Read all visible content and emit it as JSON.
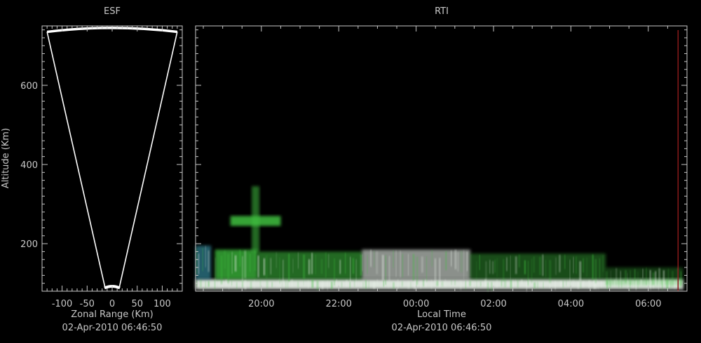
{
  "colors": {
    "background": "#000000",
    "axis": "#c8c8c8",
    "fan_outline": "#ffffff",
    "echo_green": "#3fbf3f",
    "echo_white": "#e8f0e8",
    "echo_cyan": "#3fa8c0",
    "time_marker": "#8b1a1a"
  },
  "chart_data": [
    {
      "type": "scatter",
      "title": "ESF",
      "xlabel": "Zonal Range (Km)",
      "ylabel": "Altitude (Km)",
      "footer": "02-Apr-2010 06:46:50",
      "xlim": [
        -140,
        140
      ],
      "ylim": [
        80,
        750
      ],
      "xticks": [
        -100,
        -50,
        0,
        50,
        100
      ],
      "xtick_labels": [
        "-100",
        "-50",
        "0",
        "50",
        "100"
      ],
      "yticks": [
        200,
        400,
        600
      ],
      "ytick_labels": [
        "200",
        "400",
        "600"
      ],
      "fan": {
        "apex": [
          0,
          88
        ],
        "left_top": [
          -130,
          735
        ],
        "right_top": [
          130,
          735
        ],
        "arc_peak_altitude": 745
      }
    },
    {
      "type": "heatmap",
      "title": "RTI",
      "xlabel": "Local Time",
      "footer": "02-Apr-2010 06:46:50",
      "xlim_hours": [
        18.3,
        31.0
      ],
      "ylim": [
        80,
        750
      ],
      "xticks_hours": [
        20,
        22,
        24,
        26,
        28,
        30
      ],
      "xtick_labels": [
        "20:00",
        "22:00",
        "00:00",
        "02:00",
        "04:00",
        "06:00"
      ],
      "yticks": [
        200,
        400,
        600
      ],
      "current_time_hours": 30.77,
      "echo_regions": [
        {
          "t0": 18.3,
          "t1": 30.9,
          "alt0": 85,
          "alt1": 110,
          "color": "echo_white",
          "intensity": 0.95
        },
        {
          "t0": 18.3,
          "t1": 18.7,
          "alt0": 110,
          "alt1": 195,
          "color": "echo_cyan",
          "intensity": 0.55
        },
        {
          "t0": 18.8,
          "t1": 19.9,
          "alt0": 110,
          "alt1": 185,
          "color": "echo_green",
          "intensity": 0.75
        },
        {
          "t0": 19.9,
          "t1": 22.6,
          "alt0": 110,
          "alt1": 180,
          "color": "echo_green",
          "intensity": 0.55
        },
        {
          "t0": 22.6,
          "t1": 25.4,
          "alt0": 110,
          "alt1": 185,
          "color": "echo_white",
          "intensity": 0.6
        },
        {
          "t0": 25.4,
          "t1": 28.9,
          "alt0": 110,
          "alt1": 175,
          "color": "echo_green",
          "intensity": 0.4
        },
        {
          "t0": 28.9,
          "t1": 30.9,
          "alt0": 95,
          "alt1": 140,
          "color": "echo_green",
          "intensity": 0.3
        },
        {
          "t0": 19.2,
          "t1": 20.5,
          "alt0": 245,
          "alt1": 270,
          "color": "echo_green",
          "intensity": 0.85
        },
        {
          "t0": 19.75,
          "t1": 19.95,
          "alt0": 180,
          "alt1": 345,
          "color": "echo_green",
          "intensity": 0.55
        }
      ]
    }
  ]
}
